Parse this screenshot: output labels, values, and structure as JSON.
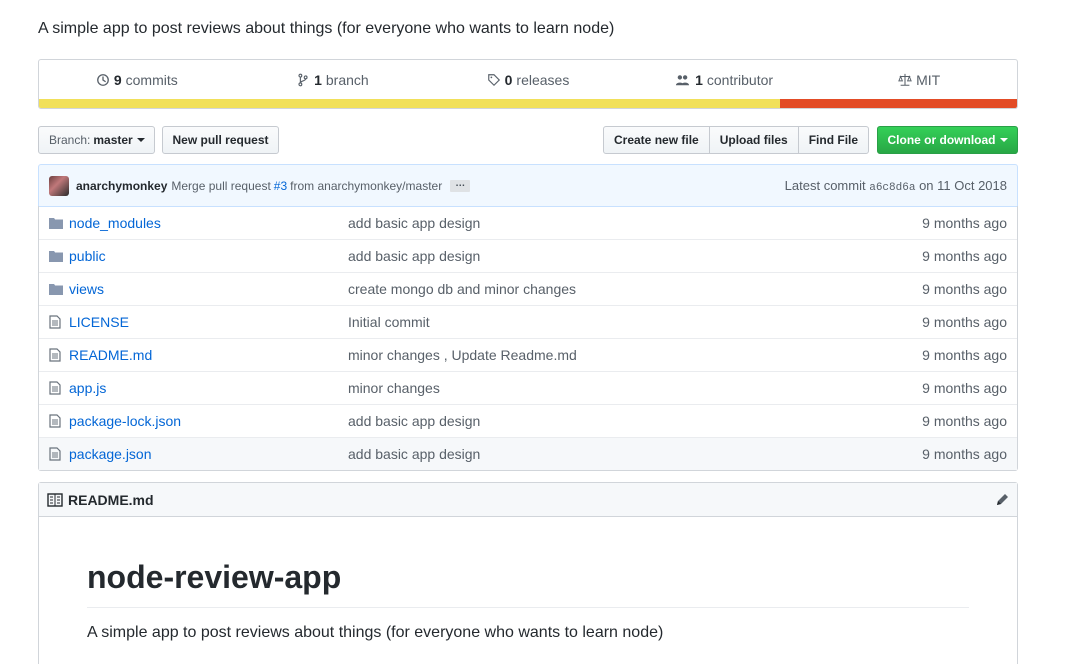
{
  "repo": {
    "description": "A simple app to post reviews about things (for everyone who wants to learn node)"
  },
  "stats": {
    "commits_count": "9",
    "commits_label": "commits",
    "branches_count": "1",
    "branches_label": "branch",
    "releases_count": "0",
    "releases_label": "releases",
    "contributors_count": "1",
    "contributors_label": "contributor",
    "license": "MIT"
  },
  "languages": [
    {
      "color": "#f1e05a",
      "share": 0.758
    },
    {
      "color": "#e34c26",
      "share": 0.242
    }
  ],
  "toolbar": {
    "branch_prefix": "Branch:",
    "branch_name": "master",
    "new_pr": "New pull request",
    "create_file": "Create new file",
    "upload_files": "Upload files",
    "find_file": "Find File",
    "clone": "Clone or download"
  },
  "latest_commit": {
    "author": "anarchymonkey",
    "message_prefix": "Merge pull request",
    "pr_ref": "#3",
    "message_suffix": "from anarchymonkey/master",
    "ellipsis": "…",
    "label": "Latest commit",
    "sha": "a6c8d6a",
    "date": "on 11 Oct 2018"
  },
  "files": [
    {
      "type": "dir",
      "name": "node_modules",
      "message": "add basic app design",
      "age": "9 months ago"
    },
    {
      "type": "dir",
      "name": "public",
      "message": "add basic app design",
      "age": "9 months ago"
    },
    {
      "type": "dir",
      "name": "views",
      "message": "create mongo db and minor changes",
      "age": "9 months ago"
    },
    {
      "type": "file",
      "name": "LICENSE",
      "message": "Initial commit",
      "age": "9 months ago"
    },
    {
      "type": "file",
      "name": "README.md",
      "message": "minor changes , Update Readme.md",
      "age": "9 months ago"
    },
    {
      "type": "file",
      "name": "app.js",
      "message": "minor changes",
      "age": "9 months ago"
    },
    {
      "type": "file",
      "name": "package-lock.json",
      "message": "add basic app design",
      "age": "9 months ago"
    },
    {
      "type": "file",
      "name": "package.json",
      "message": "add basic app design",
      "age": "9 months ago"
    }
  ],
  "readme": {
    "filename": "README.md",
    "title": "node-review-app",
    "body": "A simple app to post reviews about things (for everyone who wants to learn node)"
  }
}
